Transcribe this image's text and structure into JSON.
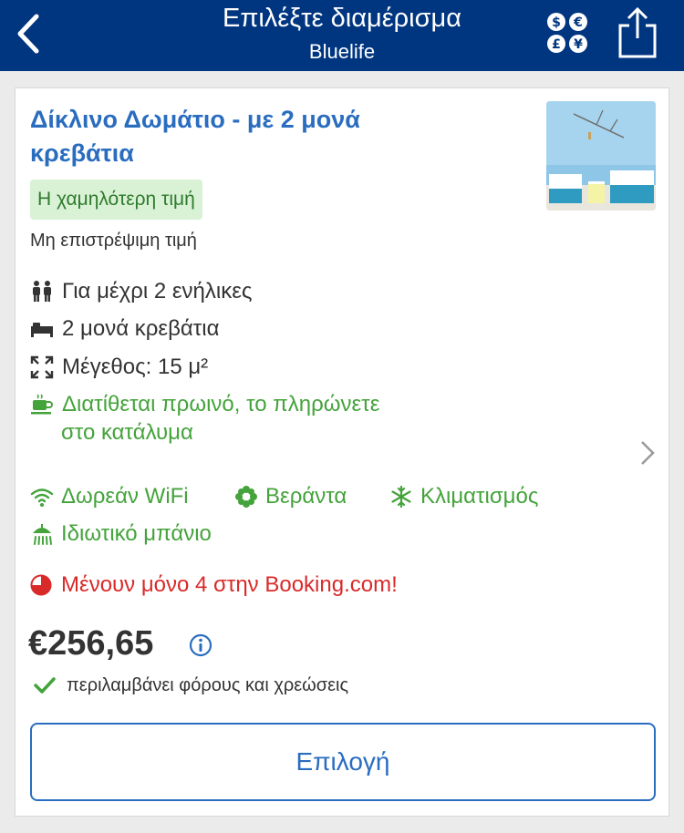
{
  "header": {
    "title": "Επιλέξτε διαμέρισμα",
    "subtitle": "Bluelife",
    "icons": {
      "back": "chevron-left-icon",
      "currency": "currency-icon",
      "share": "share-icon"
    }
  },
  "room": {
    "title": "Δίκλινο Δωμάτιο - με 2 μονά κρεβάτια",
    "badge": "Η χαμηλότερη τιμή",
    "policy": "Μη επιστρέψιμη τιμή",
    "features": {
      "guests": "Για μέχρι 2 ενήλικες",
      "beds": "2 μονά κρεβάτια",
      "size": "Μέγεθος: 15 μ²",
      "breakfast_line1": "Διατίθεται πρωινό, το πληρώνετε",
      "breakfast_line2": "στο κατάλυμα"
    },
    "facilities": {
      "wifi": "Δωρεάν WiFi",
      "balcony": "Βεράντα",
      "ac": "Κλιματισμός",
      "bathroom": "Ιδιωτικό μπάνιο"
    },
    "urgency": "Μένουν μόνο 4 στην Booking.com!",
    "price": "€256,65",
    "taxes": "περιλαμβάνει φόρους και χρεώσεις",
    "select_label": "Επιλογή"
  },
  "colors": {
    "header_bg": "#003580",
    "link_blue": "#2a6dbf",
    "green": "#44a33b",
    "badge_bg": "#d9f2d6",
    "red": "#d92a2a"
  }
}
